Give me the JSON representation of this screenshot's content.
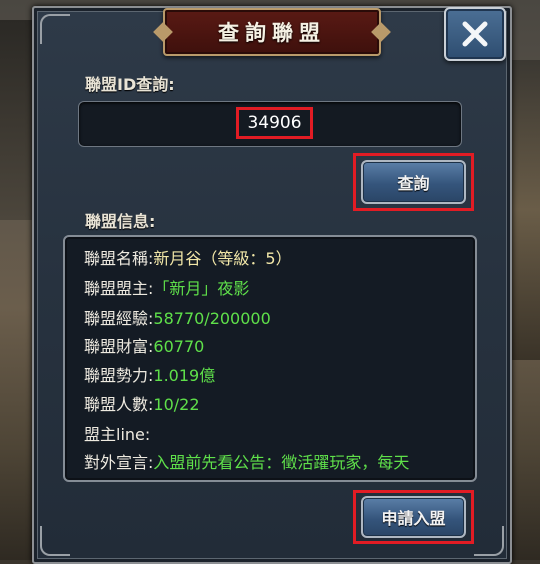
{
  "dialog": {
    "title": "查詢聯盟",
    "close_icon": "close-icon"
  },
  "search": {
    "label": "聯盟ID查詢:",
    "value": "34906",
    "button_label": "查詢"
  },
  "info": {
    "section_label": "聯盟信息:",
    "rows": [
      {
        "key": "聯盟名稱:",
        "value": "新月谷（等級：5）"
      },
      {
        "key": "聯盟盟主:",
        "value": "「新月」夜影"
      },
      {
        "key": "聯盟經驗:",
        "value": "58770/200000"
      },
      {
        "key": "聯盟財富:",
        "value": "60770"
      },
      {
        "key": "聯盟勢力:",
        "value": "1.019億"
      },
      {
        "key": "聯盟人數:",
        "value": "10/22"
      },
      {
        "key": "盟主line:",
        "value": ""
      },
      {
        "key": "對外宣言:",
        "value": "入盟前先看公告：徵活躍玩家，每天"
      }
    ]
  },
  "actions": {
    "apply_label": "申請入盟"
  },
  "colors": {
    "highlight": "#e21c24",
    "value_green": "#5fe04a",
    "value_yellow": "#f2e7a8"
  }
}
